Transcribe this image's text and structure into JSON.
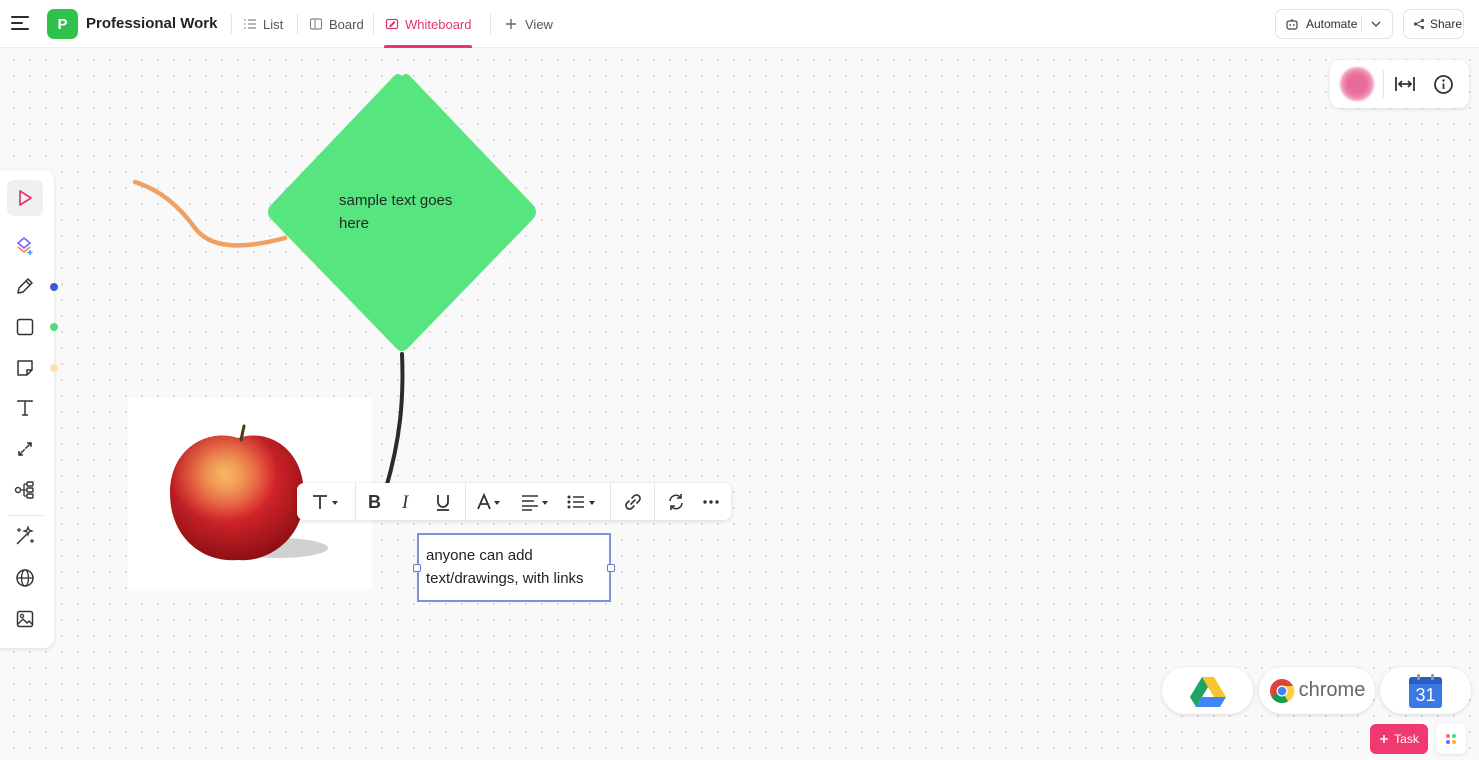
{
  "header": {
    "space_initial": "P",
    "space_title": "Professional Work",
    "tabs": [
      {
        "label": "List",
        "icon": "list-icon"
      },
      {
        "label": "Board",
        "icon": "board-icon"
      },
      {
        "label": "Whiteboard",
        "icon": "whiteboard-icon",
        "active": true
      },
      {
        "label": "View",
        "icon": "plus-icon"
      }
    ],
    "automate_label": "Automate",
    "share_label": "Share"
  },
  "right_panel": {
    "icons": [
      "user-avatar",
      "fit-width-icon",
      "info-icon"
    ]
  },
  "left_toolbar": {
    "tools": [
      "pointer-icon",
      "ai-shapes-icon",
      "pen-icon",
      "rectangle-icon",
      "sticky-note-icon",
      "text-icon",
      "connector-icon",
      "mind-map-icon",
      "magic-icon",
      "globe-icon",
      "image-icon"
    ],
    "dot_colors": {
      "pen": "#3b5bd6",
      "shape": "#4fdc78",
      "sticky": "#ffe0b2"
    }
  },
  "canvas": {
    "diamond_text": "sample text goes here",
    "diamond_color": "#57e57f",
    "curve_color": "#f0a060",
    "textbox_text": "anyone can add text/drawings, with links"
  },
  "format_toolbar": {
    "items": [
      "text-style-icon",
      "bold-icon",
      "italic-icon",
      "underline-icon",
      "font-color-icon",
      "align-icon",
      "list-icon",
      "link-icon",
      "convert-icon",
      "more-icon"
    ]
  },
  "integrations": {
    "chrome_label": "chrome",
    "calendar_day": "31"
  },
  "task_button": {
    "label": "Task"
  },
  "colors": {
    "accent": "#e5356a",
    "task": "#f0396e",
    "space": "#2fc24b"
  }
}
